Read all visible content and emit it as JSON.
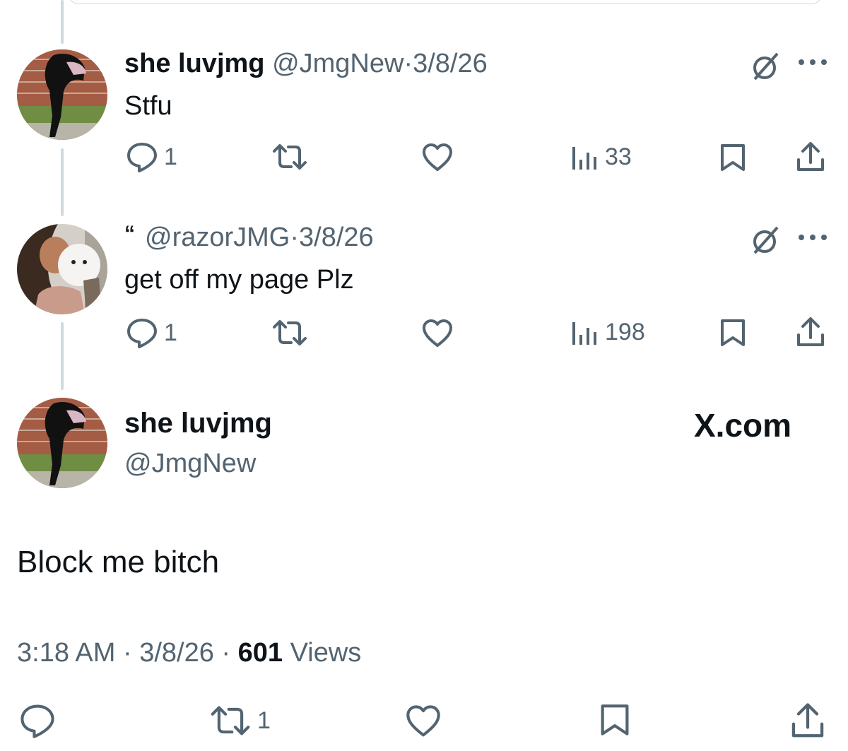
{
  "thread": [
    {
      "display_name": "she luvjmg",
      "handle": "@JmgNew",
      "separator": "·",
      "date": "3/8/26",
      "text": "Stfu",
      "replies": "1",
      "reposts": "",
      "likes": "",
      "views": "33"
    },
    {
      "quote_mark": "“",
      "display_name": "",
      "handle": "@razorJMG",
      "separator": "·",
      "date": "3/8/26",
      "text": "get off my page Plz",
      "replies": "1",
      "reposts": "",
      "likes": "",
      "views": "198"
    }
  ],
  "main_post": {
    "display_name": "she luvjmg",
    "handle": "@JmgNew",
    "brand": "X.com",
    "text": "Block me bitch",
    "time": "3:18 AM",
    "separator": "·",
    "date": "3/8/26",
    "views_count": "601",
    "views_label": "Views",
    "replies": "",
    "reposts": "1",
    "likes": ""
  },
  "colors": {
    "text_primary": "#0f1419",
    "text_secondary": "#536471",
    "thread_line": "#cfd9de"
  },
  "icons": {
    "reply": "speech-bubble-icon",
    "repost": "repost-arrows-icon",
    "like": "heart-icon",
    "views": "bar-chart-icon",
    "bookmark": "bookmark-icon",
    "share": "share-upload-icon",
    "grok": "grok-slash-circle-icon",
    "more": "ellipsis-icon"
  }
}
